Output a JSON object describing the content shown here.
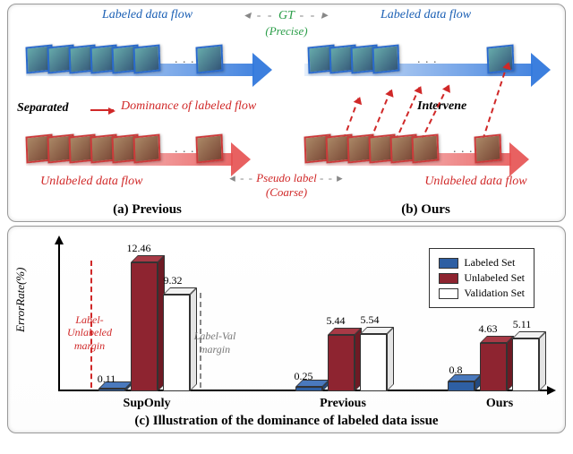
{
  "top": {
    "labeled_flow": "Labeled data flow",
    "unlabeled_flow": "Unlabeled data flow",
    "gt": "GT",
    "gt_sub": "(Precise)",
    "pseudo": "Pseudo label",
    "pseudo_sub": "(Coarse)",
    "separated": "Separated",
    "dominance": "Dominance of labeled flow",
    "intervene": "Intervene",
    "caption_a": "(a) Previous",
    "caption_b": "(b) Ours",
    "dash": "-  -  -  -"
  },
  "chart_data": {
    "type": "bar",
    "ylabel": "ErrorRate(%)",
    "ylim": [
      0,
      13
    ],
    "categories": [
      "SupOnly",
      "Previous",
      "Ours"
    ],
    "series": [
      {
        "name": "Labeled Set",
        "values": [
          0.11,
          0.25,
          0.8
        ]
      },
      {
        "name": "Unlabeled Set",
        "values": [
          12.46,
          5.44,
          4.63
        ]
      },
      {
        "name": "Validation Set",
        "values": [
          9.32,
          5.54,
          5.11
        ]
      }
    ],
    "annotations": {
      "label_unlabel_margin": "Label-Unlabeled margin",
      "label_val_margin": "Label-Val margin"
    },
    "caption": "(c) Illustration of the dominance of labeled data issue"
  }
}
